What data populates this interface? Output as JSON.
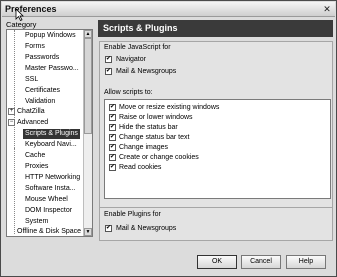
{
  "window": {
    "title": "Preferences",
    "close_glyph": "✕"
  },
  "sidebar": {
    "label": "Category",
    "items": [
      {
        "label": "Popup Windows"
      },
      {
        "label": "Forms"
      },
      {
        "label": "Passwords"
      },
      {
        "label": "Master Passwo..."
      },
      {
        "label": "SSL"
      },
      {
        "label": "Certificates"
      },
      {
        "label": "Validation"
      },
      {
        "label": "ChatZilla"
      },
      {
        "label": "Advanced"
      },
      {
        "label": "Scripts & Plugins"
      },
      {
        "label": "Keyboard Navi..."
      },
      {
        "label": "Cache"
      },
      {
        "label": "Proxies"
      },
      {
        "label": "HTTP Networking"
      },
      {
        "label": "Software Insta..."
      },
      {
        "label": "Mouse Wheel"
      },
      {
        "label": "DOM Inspector"
      },
      {
        "label": "System"
      },
      {
        "label": "Offline & Disk Space"
      }
    ]
  },
  "panel": {
    "title": "Scripts & Plugins",
    "javascript": {
      "title": "Enable JavaScript for",
      "options": [
        {
          "label": "Navigator",
          "checked": true
        },
        {
          "label": "Mail & Newsgroups",
          "checked": true
        }
      ]
    },
    "allow": {
      "title": "Allow scripts to:",
      "options": [
        {
          "label": "Move or resize existing windows",
          "checked": true
        },
        {
          "label": "Raise or lower windows",
          "checked": true
        },
        {
          "label": "Hide the status bar",
          "checked": true
        },
        {
          "label": "Change status bar text",
          "checked": true
        },
        {
          "label": "Change images",
          "checked": true
        },
        {
          "label": "Create or change cookies",
          "checked": true
        },
        {
          "label": "Read cookies",
          "checked": true
        }
      ]
    },
    "plugins": {
      "title": "Enable Plugins for",
      "options": [
        {
          "label": "Mail & Newsgroups",
          "checked": true
        }
      ]
    }
  },
  "buttons": {
    "ok": "OK",
    "cancel": "Cancel",
    "help": "Help"
  },
  "expander": {
    "collapsed": "+",
    "expanded": "−"
  },
  "check_glyph": "✔",
  "scroll": {
    "up": "▲",
    "down": "▼"
  }
}
